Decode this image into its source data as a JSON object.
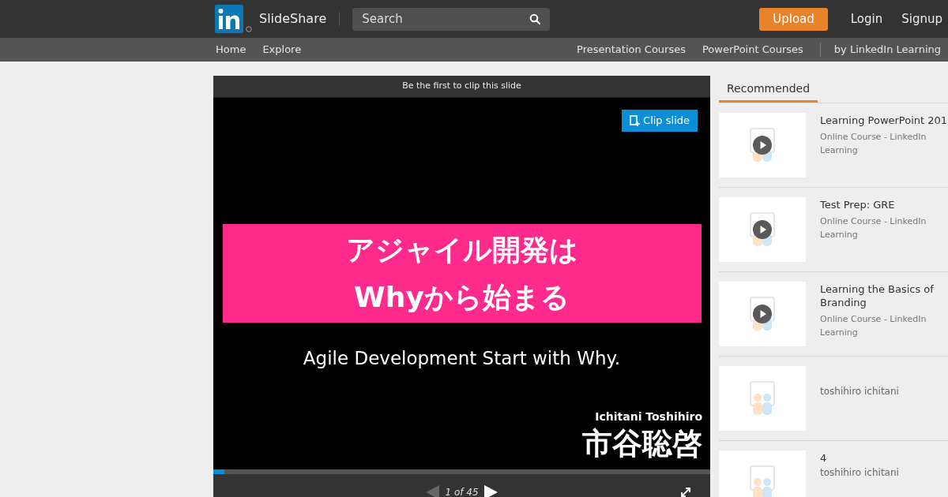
{
  "header": {
    "brand": "SlideShare",
    "search": {
      "placeholder": "Search"
    },
    "upload": "Upload",
    "login": "Login",
    "signup": "Signup"
  },
  "subnav": {
    "left": [
      "Home",
      "Explore"
    ],
    "right": [
      "Presentation Courses",
      "PowerPoint Courses"
    ],
    "extra": "by LinkedIn Learning"
  },
  "player": {
    "clip_banner": "Be the first to clip this slide",
    "clip_button": "Clip slide",
    "slide": {
      "title_lines": [
        "アジャイル開発は",
        "Whyから始まる"
      ],
      "subtitle": "Agile Development Start with Why.",
      "author_en": "Ichitani Toshihiro",
      "author_ja": "市谷聡啓"
    },
    "progress": {
      "level": 0.022
    },
    "counter": "1 of 45"
  },
  "sidebar": {
    "tab": {
      "label": "Recommended",
      "selected": true
    },
    "items": [
      {
        "kind": "course",
        "title": "Learning PowerPoint 201",
        "subtitle": "Online Course - LinkedIn Learning"
      },
      {
        "kind": "course",
        "title": "Test Prep: GRE",
        "subtitle": "Online Course - LinkedIn Learning"
      },
      {
        "kind": "course",
        "title": "Learning the Basics of Branding",
        "subtitle": "Online Course - LinkedIn Learning"
      },
      {
        "kind": "deck",
        "subtitle": "toshihiro ichitani"
      },
      {
        "kind": "deck",
        "title": "4",
        "subtitle": "toshihiro ichitani"
      }
    ]
  }
}
